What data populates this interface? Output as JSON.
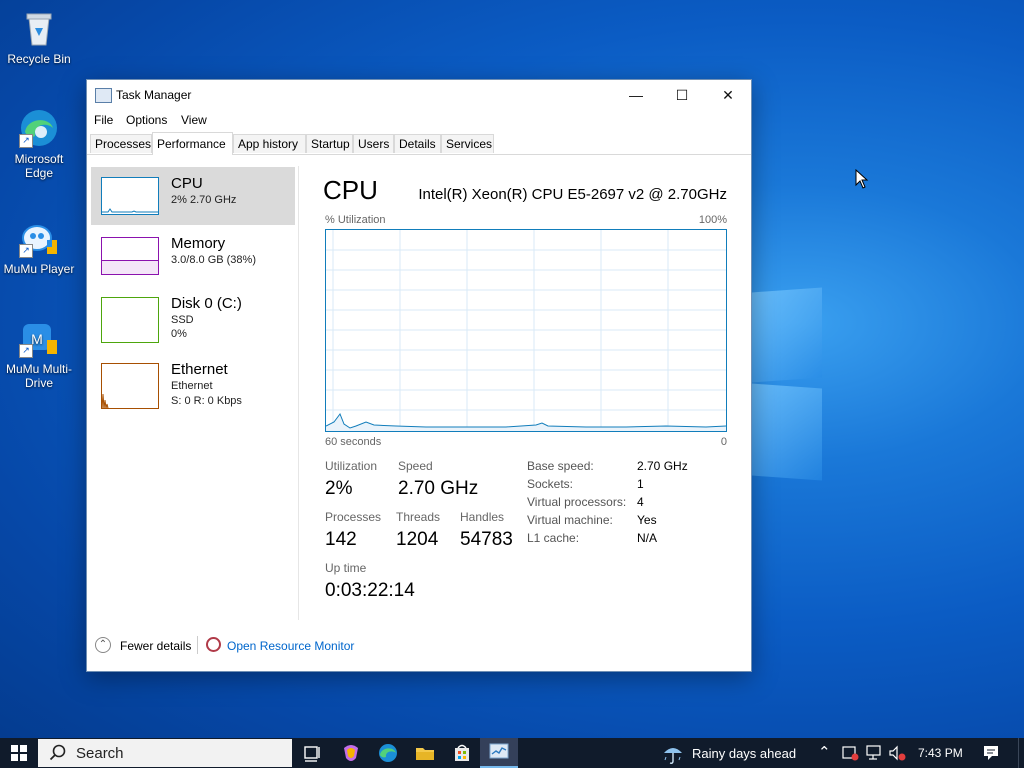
{
  "desktop": {
    "icons": [
      {
        "label": "Recycle Bin"
      },
      {
        "label": "Microsoft Edge"
      },
      {
        "label": "MuMu Player"
      },
      {
        "label": "MuMu Multi-Drive"
      }
    ]
  },
  "window": {
    "title": "Task Manager",
    "controls": {
      "minimize": "—",
      "maximize": "☐",
      "close": "✕"
    },
    "menu": [
      "File",
      "Options",
      "View"
    ],
    "tabs": [
      "Processes",
      "Performance",
      "App history",
      "Startup",
      "Users",
      "Details",
      "Services"
    ],
    "active_tab": "Performance",
    "sidebar": [
      {
        "title": "CPU",
        "lines": [
          "2%  2.70 GHz"
        ],
        "color": "#117dbb"
      },
      {
        "title": "Memory",
        "lines": [
          "3.0/8.0 GB (38%)"
        ],
        "color": "#8b12ae"
      },
      {
        "title": "Disk 0 (C:)",
        "lines": [
          "SSD",
          "0%"
        ],
        "color": "#4da60c"
      },
      {
        "title": "Ethernet",
        "lines": [
          "Ethernet",
          "S: 0  R: 0 Kbps"
        ],
        "color": "#a74f01"
      }
    ],
    "main": {
      "heading": "CPU",
      "cpu_model": "Intel(R) Xeon(R) CPU E5-2697 v2 @ 2.70GHz",
      "graph_label_left": "% Utilization",
      "graph_label_right": "100%",
      "graph_time_left": "60 seconds",
      "graph_time_right": "0",
      "stats": {
        "utilization": {
          "label": "Utilization",
          "value": "2%"
        },
        "speed": {
          "label": "Speed",
          "value": "2.70 GHz"
        },
        "processes": {
          "label": "Processes",
          "value": "142"
        },
        "threads": {
          "label": "Threads",
          "value": "1204"
        },
        "handles": {
          "label": "Handles",
          "value": "54783"
        },
        "uptime": {
          "label": "Up time",
          "value": "0:03:22:14"
        }
      },
      "details": [
        {
          "key": "Base speed:",
          "value": "2.70 GHz"
        },
        {
          "key": "Sockets:",
          "value": "1"
        },
        {
          "key": "Virtual processors:",
          "value": "4"
        },
        {
          "key": "Virtual machine:",
          "value": "Yes"
        },
        {
          "key": "L1 cache:",
          "value": "N/A"
        }
      ]
    },
    "footer": {
      "fewer_details": "Fewer details",
      "open_resource_monitor": "Open Resource Monitor"
    }
  },
  "taskbar": {
    "search_placeholder": "Search",
    "weather": "Rainy days ahead",
    "time": "7:43 PM"
  },
  "colors": {
    "accent": "#117dbb",
    "link": "#0066cc",
    "taskbar": "#101b2b"
  }
}
